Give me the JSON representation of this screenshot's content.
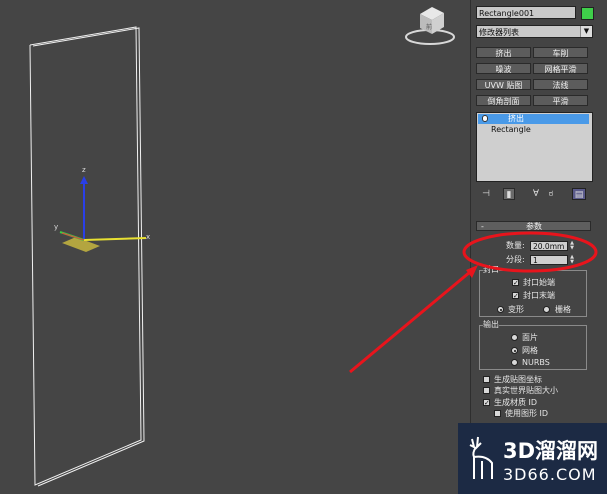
{
  "object_name": "Rectangle001",
  "object_color": "#3fcf4a",
  "modifier_list_label": "修改器列表",
  "modifier_buttons": [
    "挤出",
    "车削",
    "噪波",
    "网格平滑",
    "UVW 贴图",
    "法线",
    "倒角剖面",
    "平滑"
  ],
  "stack": {
    "top_item": "挤出",
    "base_item": "Rectangle"
  },
  "toolbar_icons": [
    "pin-stack-icon",
    "show-end-result-icon",
    "make-unique-icon",
    "remove-modifier-icon",
    "configure-sets-icon"
  ],
  "parameters": {
    "rollout_title": "参数",
    "rollout_toggle": "-",
    "amount_label": "数量:",
    "amount_value": "20.0mm",
    "segments_label": "分段:",
    "segments_value": "1",
    "capping_group_label": "封口",
    "cap_start_label": "封口始端",
    "cap_end_label": "封口末端",
    "cap_start_checked": true,
    "cap_end_checked": true,
    "morph_label": "变形",
    "grid_label": "栅格",
    "output_group_label": "输出",
    "output_patch_label": "面片",
    "output_mesh_label": "网格",
    "output_nurbs_label": "NURBS",
    "gen_mapping_label": "生成贴图坐标",
    "real_world_label": "真实世界贴图大小",
    "gen_mat_ids_label": "生成材质 ID",
    "use_shape_ids_label": "使用图形 ID"
  },
  "viewcube_label": "前",
  "gizmo_axes": {
    "x": "x",
    "y": "y",
    "z": "z"
  },
  "watermark": {
    "line1": "3D溜溜网",
    "line2": "3D66.COM"
  },
  "annotation_color": "#e8141c"
}
